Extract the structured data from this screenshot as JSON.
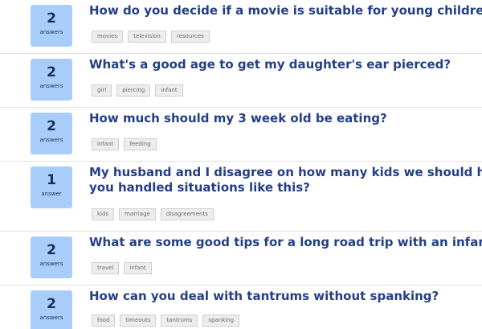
{
  "questions": [
    {
      "answers": "2",
      "answers_label": "answers",
      "title": "How do you decide if a movie is suitable for young childre",
      "tags": [
        "movies",
        "television",
        "resources"
      ]
    },
    {
      "answers": "2",
      "answers_label": "answers",
      "title": "What's a good age to get my daughter's ear pierced?",
      "tags": [
        "girl",
        "piercing",
        "infant"
      ]
    },
    {
      "answers": "2",
      "answers_label": "answers",
      "title": "How much should my 3 week old be eating?",
      "tags": [
        "infant",
        "feeding"
      ]
    },
    {
      "answers": "1",
      "answers_label": "answer",
      "title": "My husband and I disagree on how many kids we should ha\nyou handled situations like this?",
      "tags": [
        "kids",
        "marriage",
        "disagreements"
      ]
    },
    {
      "answers": "2",
      "answers_label": "answers",
      "title": "What are some good tips for a long road trip with an infan",
      "tags": [
        "travel",
        "infant"
      ]
    },
    {
      "answers": "2",
      "answers_label": "answers",
      "title": "How can you deal with tantrums without spanking?",
      "tags": [
        "food",
        "timeouts",
        "tantrums",
        "spanking"
      ]
    }
  ]
}
